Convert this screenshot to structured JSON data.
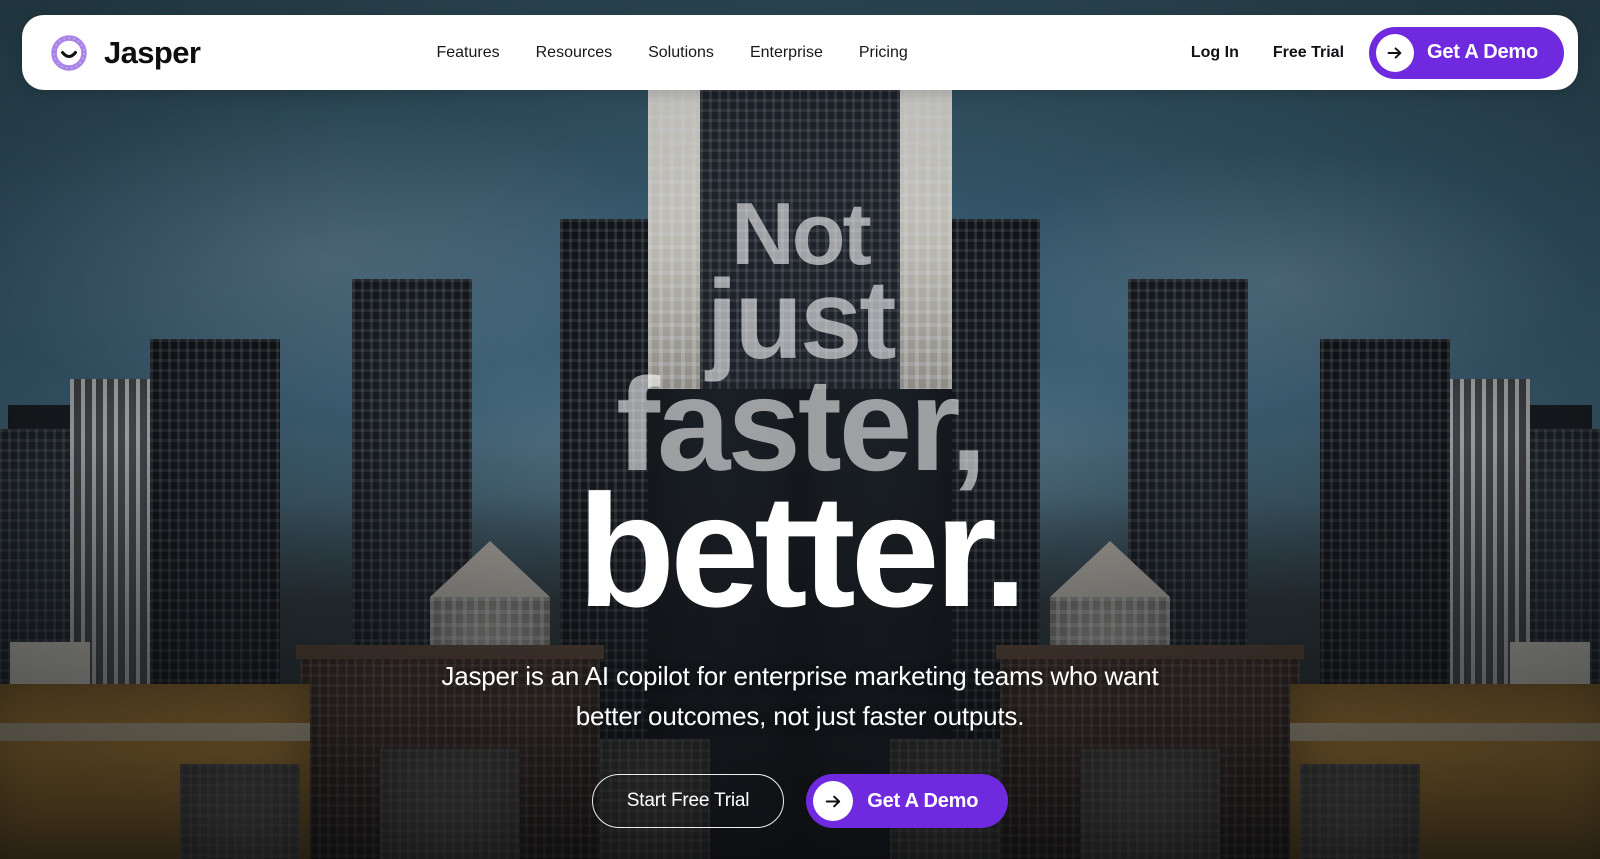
{
  "brand": {
    "name": "Jasper",
    "logo_icon": "jasper-smile-ring-icon",
    "logo_color": "#9f7be0"
  },
  "nav": {
    "links": [
      {
        "label": "Features"
      },
      {
        "label": "Resources"
      },
      {
        "label": "Solutions"
      },
      {
        "label": "Enterprise"
      },
      {
        "label": "Pricing"
      }
    ],
    "login_label": "Log In",
    "free_trial_label": "Free Trial",
    "demo_label": "Get A Demo",
    "demo_icon": "arrow-right-icon",
    "accent_color": "#6f2ae0"
  },
  "hero": {
    "headline_lines": [
      {
        "text": "Not",
        "emphasis": "dim"
      },
      {
        "text": "just",
        "emphasis": "dim"
      },
      {
        "text": "faster,",
        "emphasis": "dim"
      },
      {
        "text": "better.",
        "emphasis": "bright"
      }
    ],
    "subheadline": "Jasper is an AI copilot for enterprise marketing teams who want better outcomes, not just faster outputs.",
    "cta_primary_label": "Get A Demo",
    "cta_primary_icon": "arrow-right-icon",
    "cta_secondary_label": "Start Free Trial",
    "dim_text_color": "rgba(255,255,255,0.58)",
    "bright_text_color": "#ffffff",
    "background_description": "mirrored dark city skyline at dusk"
  }
}
